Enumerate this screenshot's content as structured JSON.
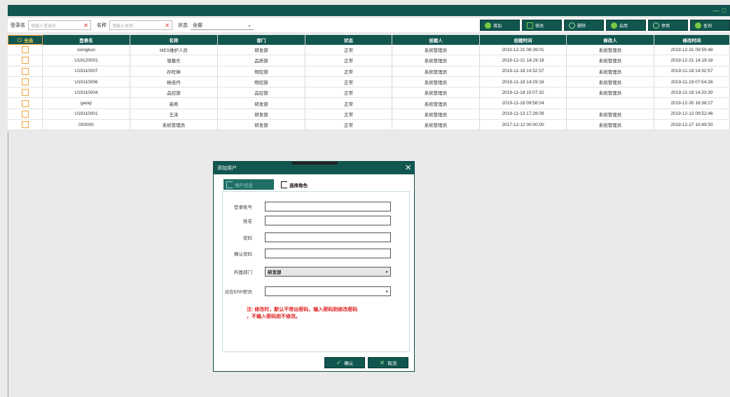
{
  "window": {
    "controls": [
      "—",
      "□"
    ]
  },
  "filter": {
    "login_label": "登录名",
    "login_placeholder": "请输入登录名",
    "name_label": "名称",
    "name_placeholder": "请输入名称",
    "status_label": "状态",
    "status_value": "全部"
  },
  "toolbar": {
    "add": "增加",
    "edit": "修改",
    "delete": "删除",
    "enable": "启用",
    "disable": "停用",
    "query": "查询"
  },
  "table": {
    "select_all": "全选",
    "columns": [
      "登录名",
      "名称",
      "部门",
      "状态",
      "创建人",
      "创建时间",
      "修改人",
      "修改时间"
    ],
    "rows": [
      [
        "xiongkun",
        "MES维护人员",
        "研发部",
        "正常",
        "系统管理员",
        "2019-12-31 08:39:01",
        "系统管理员",
        "2019-12-31 09:59:48"
      ],
      [
        "U19120001",
        "邹嘉乐",
        "品质部",
        "正常",
        "系统管理员",
        "2019-12-21 14:19:18",
        "系统管理员",
        "2019-12-21 14:19:18"
      ],
      [
        "U19110007",
        "孙旺翀",
        "物控部",
        "正常",
        "系统管理员",
        "2019-11-18 14:32:57",
        "系统管理员",
        "2019-11-18 14:32:57"
      ],
      [
        "U19110006",
        "杨佳丹",
        "物控部",
        "正常",
        "系统管理员",
        "2019-11-18 14:29:16",
        "系统管理员",
        "2019-11-19 07:54:28"
      ],
      [
        "U19110004",
        "品控部",
        "品控部",
        "正常",
        "系统管理员",
        "2019-11-18 10:07:32",
        "系统管理员",
        "2019-11-18 14:33:30"
      ],
      [
        "gaoqi",
        "高奇",
        "研发部",
        "正常",
        "系统管理员",
        "2019-11-18 09:58:04",
        "",
        "2019-12-30 16:38:27"
      ],
      [
        "U19110001",
        "王泽",
        "研发部",
        "正常",
        "系统管理员",
        "2019-11-13 17:28:09",
        "系统管理员",
        "2019-12-12 09:52:46"
      ],
      [
        "000000",
        "系统管理员",
        "研发部",
        "正常",
        "系统管理员",
        "2017-12-12 00:00:00",
        "系统管理员",
        "2019-12-27 10:49:50"
      ]
    ]
  },
  "dialog": {
    "title": "添加用户",
    "tab_user_info": "用户信息",
    "tab_select_role": "选择角色",
    "fields": {
      "account": "登录账号",
      "name": "姓名",
      "password": "密码",
      "confirm_password": "确认密码",
      "department": "所属部门",
      "department_value": "研发部",
      "erp": "对应ERP职员",
      "erp_value": ""
    },
    "note_line1": "注: 修改时，默认不带出密码，输入密码则修改密码",
    "note_line2": "，不输入密码则不修改。",
    "confirm": "确认",
    "cancel": "取消"
  },
  "colors": {
    "header": "#11564f",
    "accent": "#7ac943",
    "checkbox": "#f2a33a",
    "note": "#e02020"
  }
}
